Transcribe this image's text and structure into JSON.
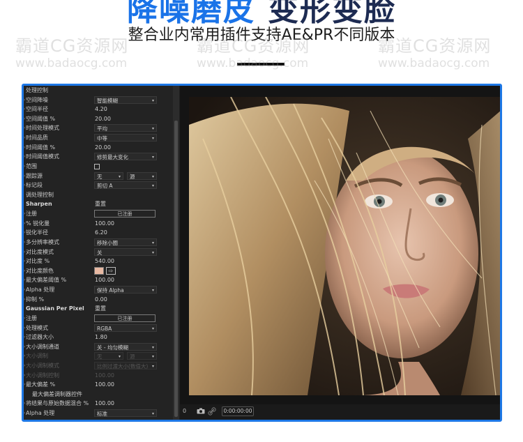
{
  "banner": {
    "title_blue": "降噪磨皮",
    "title_dark": "变形变脸",
    "subtitle": "整合业内常用插件支持AE&PR不同版本"
  },
  "watermark": {
    "brand": "霸道CG资源网",
    "url": "www.badaocg.com"
  },
  "effects_panel": {
    "rows": [
      {
        "label": "处理控制",
        "kind": "text"
      },
      {
        "label": "空间降噪",
        "kind": "dropdown",
        "value": "智能模糊"
      },
      {
        "label": "空间半径",
        "kind": "number",
        "value": "4.20"
      },
      {
        "label": "空间阈值 %",
        "kind": "number",
        "value": "20.00"
      },
      {
        "label": "时间处理模式",
        "kind": "dropdown",
        "value": "平均"
      },
      {
        "label": "时间品质",
        "kind": "dropdown",
        "value": "中等"
      },
      {
        "label": "时间阈值 %",
        "kind": "number",
        "value": "20.00"
      },
      {
        "label": "时间阈值模式",
        "kind": "dropdown",
        "value": "修剪最大变化"
      },
      {
        "label": "范围",
        "kind": "checkbox"
      },
      {
        "label": "跟踪源",
        "kind": "dropdown2",
        "value": "无",
        "value2": "源"
      },
      {
        "label": "标记段",
        "kind": "dropdown",
        "value": "剪切 A"
      },
      {
        "label": "调处理控制",
        "kind": "text"
      },
      {
        "label": "Sharpen",
        "kind": "header",
        "value": "重置"
      },
      {
        "label": "注册",
        "kind": "button",
        "value": "已注册"
      },
      {
        "label": "% 锐化量",
        "kind": "number",
        "value": "100.00"
      },
      {
        "label": "锐化半径",
        "kind": "number",
        "value": "6.20"
      },
      {
        "label": "多分辨率模式",
        "kind": "dropdown",
        "value": "移除小圈"
      },
      {
        "label": "对比度模式",
        "kind": "dropdown",
        "value": "关"
      },
      {
        "label": "对比度 %",
        "kind": "number",
        "value": "540.00"
      },
      {
        "label": "对比度颜色",
        "kind": "color"
      },
      {
        "label": "最大偏差阈值 %",
        "kind": "number",
        "value": "100.00"
      },
      {
        "label": "Alpha 处理",
        "kind": "dropdown",
        "value": "保持 Alpha"
      },
      {
        "label": "抑制 %",
        "kind": "number",
        "value": "0.00"
      },
      {
        "label": "Gaussian Per Pixel",
        "kind": "header",
        "value": "重置"
      },
      {
        "label": "注册",
        "kind": "button",
        "value": "已注册"
      },
      {
        "label": "处理模式",
        "kind": "dropdown",
        "value": "RGBA"
      },
      {
        "label": "过滤器大小",
        "kind": "number",
        "value": "1.80"
      },
      {
        "label": "大小调制通道",
        "kind": "dropdown",
        "value": "关 - 均匀模糊"
      },
      {
        "label": "大小调制",
        "kind": "dropdown2-dim",
        "value": "无",
        "value2": "源"
      },
      {
        "label": "大小调制模式",
        "kind": "dropdown-dim",
        "value": "比例过渡大小(数值大)"
      },
      {
        "label": "大小调制控制",
        "kind": "number-dim",
        "value": "100.00"
      },
      {
        "label": "最大偏差 %",
        "kind": "number",
        "value": "100.00"
      },
      {
        "label": "最大偏差调制器控件",
        "kind": "text-indent"
      },
      {
        "label": "将结果与原始数据混合 %",
        "kind": "number",
        "value": "100.00"
      },
      {
        "label": "Alpha 处理",
        "kind": "dropdown",
        "value": "标准"
      }
    ]
  },
  "viewer": {
    "frame_number": "0",
    "timecode": "0:00:00:00",
    "icons": [
      "camera-icon",
      "link-icon"
    ]
  },
  "colors": {
    "frame_border": "#1e78e6",
    "title_blue": "#1a73e8",
    "title_dark": "#1d2b52",
    "contrast_swatch": "#e8b9a3"
  }
}
